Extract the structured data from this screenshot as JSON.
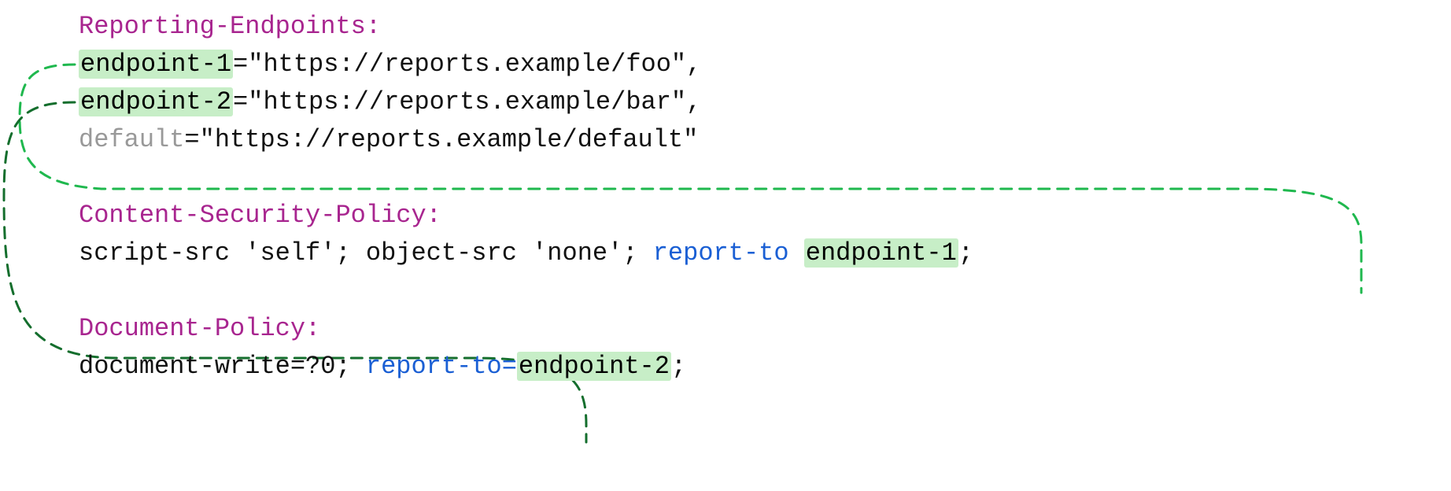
{
  "reporting": {
    "header": "Reporting-Endpoints:",
    "endpoints": [
      {
        "name": "endpoint-1",
        "url": "\"https://reports.example/foo\"",
        "trailing": ","
      },
      {
        "name": "endpoint-2",
        "url": "\"https://reports.example/bar\"",
        "trailing": ","
      },
      {
        "name": "default",
        "url": "\"https://reports.example/default\"",
        "trailing": ""
      }
    ]
  },
  "csp": {
    "header": "Content-Security-Policy:",
    "directives_prefix": "script-src 'self'; object-src 'none'; ",
    "report_to_keyword": "report-to",
    "space": " ",
    "report_to_target": "endpoint-1",
    "trailing": ";"
  },
  "docpolicy": {
    "header": "Document-Policy:",
    "directives_prefix": "document-write=?0; ",
    "report_to_keyword": "report-to",
    "equals": "=",
    "report_to_target": "endpoint-2",
    "trailing": ";"
  }
}
